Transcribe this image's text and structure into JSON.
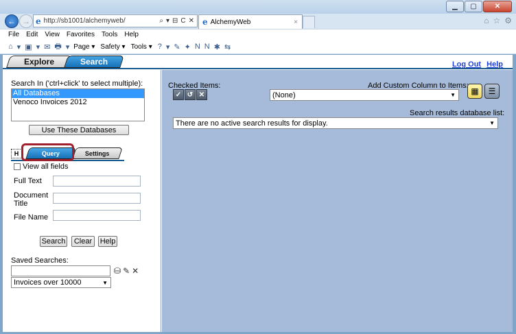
{
  "window": {
    "min_icon": "minimize-icon",
    "max_icon": "maximize-icon",
    "close_icon": "close-icon",
    "min_glyph": "▁",
    "max_glyph": "▢",
    "close_glyph": "✕"
  },
  "browser": {
    "back_glyph": "←",
    "forward_glyph": "→",
    "ie_glyph": "e",
    "url": "http://sb1001/alchemyweb/",
    "addr_tools": [
      "⌕",
      "▾",
      "⊟",
      "C",
      "✕"
    ],
    "tab_title": "AlchemyWeb",
    "tab_close": "×",
    "right_icons": [
      "⌂",
      "☆",
      "⚙"
    ],
    "menu": [
      "File",
      "Edit",
      "View",
      "Favorites",
      "Tools",
      "Help"
    ],
    "cmd_labels": {
      "page": "Page ▾",
      "safety": "Safety ▾",
      "tools": "Tools ▾"
    },
    "cmd_icons": [
      "⌂",
      "▾",
      "▣",
      "▾",
      "✉",
      "▾",
      "🖶",
      "▾"
    ],
    "cmd_icons2": [
      "?",
      "▾",
      "✎",
      "✦",
      "N",
      "N",
      "✱",
      "⇆"
    ]
  },
  "app": {
    "tabs": {
      "explore": "Explore",
      "search": "Search"
    },
    "links": {
      "logout": "Log Out",
      "help": "Help"
    },
    "left": {
      "search_in_label": "Search In ('ctrl+click' to select multiple):",
      "databases": [
        "All Databases",
        "Venoco Invoices 2012"
      ],
      "selected_db_index": 0,
      "use_button": "Use These Databases",
      "subtab_icon": "H",
      "subtabs": {
        "query": "Query",
        "settings": "Settings"
      },
      "view_all": "View all fields",
      "fields": [
        {
          "label": "Full Text",
          "value": ""
        },
        {
          "label": "Document Title",
          "value": ""
        },
        {
          "label": "File Name",
          "value": ""
        }
      ],
      "buttons": {
        "search": "Search",
        "clear": "Clear",
        "help": "Help"
      },
      "saved_label": "Saved Searches:",
      "saved_value": "",
      "saved_icons": [
        "⛁",
        "✎",
        "✕"
      ],
      "saved_select": "Invoices over 10000"
    },
    "right": {
      "checked_label": "Checked Items:",
      "checked_icons": [
        "✓",
        "↺",
        "✕"
      ],
      "custom_col_label": "Add Custom Column to Items:",
      "custom_col_value": "(None)",
      "view_icons": [
        "▦",
        "☰"
      ],
      "results_label": "Search results database list:",
      "results_value": "There are no active search results for display."
    }
  }
}
